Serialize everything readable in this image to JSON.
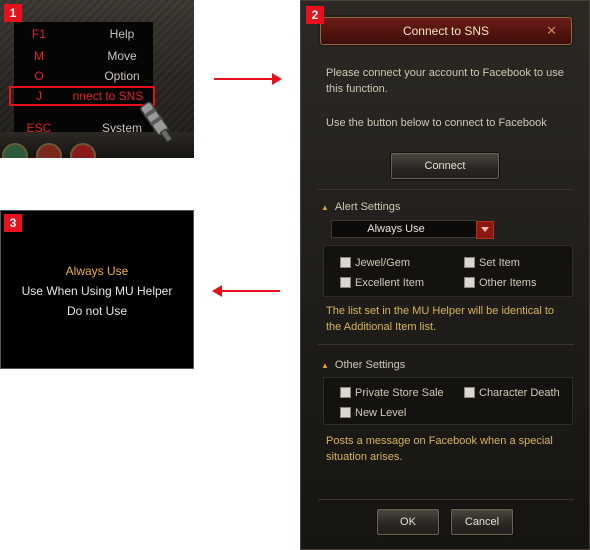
{
  "badges": [
    "1",
    "2",
    "3"
  ],
  "panel1": {
    "menu": [
      {
        "key": "F1",
        "label": "Help"
      },
      {
        "key": "M",
        "label": "Move"
      },
      {
        "key": "O",
        "label": "Option"
      },
      {
        "key": "J",
        "label": "nnect to SNS"
      },
      {
        "key": "ESC",
        "label": "System"
      }
    ],
    "highlighted_index": 3
  },
  "panel2": {
    "title": "Connect to SNS",
    "close_glyph": "✕",
    "intro_line1": "Please connect your account to Facebook to use",
    "intro_line2": "this function.",
    "intro_line3": "Use the button below to connect to Facebook",
    "connect_label": "Connect",
    "alert_heading": "Alert Settings",
    "dropdown_value": "Always Use",
    "alert_options": [
      "Jewel/Gem",
      "Set Item",
      "Excellent Item",
      "Other Items"
    ],
    "alert_note_line1": "The list set in the MU Helper will be identical to",
    "alert_note_line2": "the Additional Item list.",
    "other_heading": "Other Settings",
    "other_options": [
      "Private Store Sale",
      "Character Death",
      "New Level"
    ],
    "other_note_line1": "Posts a message on Facebook when a special",
    "other_note_line2": "situation arises.",
    "ok_label": "OK",
    "cancel_label": "Cancel"
  },
  "panel3": {
    "options": [
      "Always Use",
      "Use When Using MU Helper",
      "Do not Use"
    ],
    "selected_index": 0
  },
  "colors": {
    "badge": "#e8101a",
    "accent_gold": "#f0b030",
    "highlight_red": "#e8101a"
  }
}
